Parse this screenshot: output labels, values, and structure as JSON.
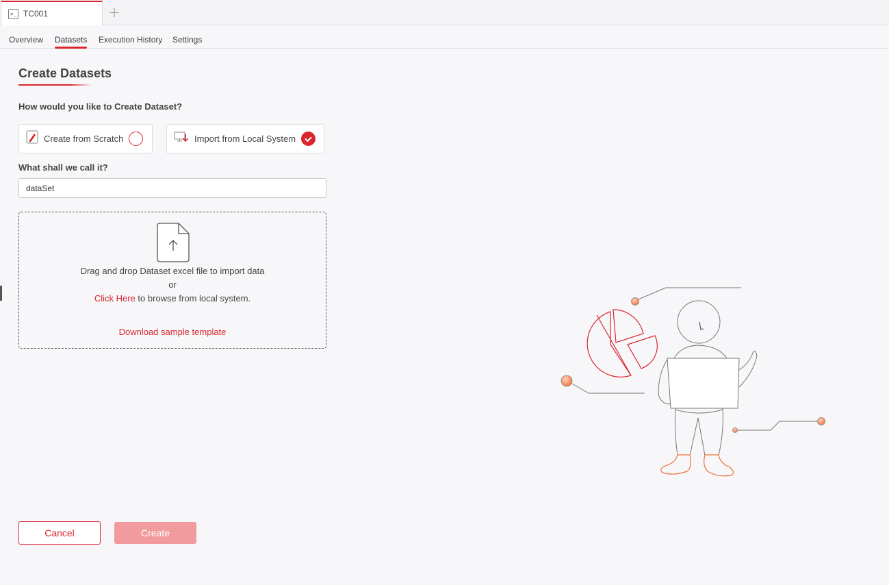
{
  "tabs": [
    {
      "label": "TC001"
    }
  ],
  "subnav": {
    "items": [
      {
        "label": "Overview"
      },
      {
        "label": "Datasets"
      },
      {
        "label": "Execution History"
      },
      {
        "label": "Settings"
      }
    ],
    "active": "Datasets"
  },
  "page": {
    "title": "Create Datasets",
    "question": "How would you like to Create Dataset?",
    "options": [
      {
        "label": "Create from Scratch",
        "icon": "pencil-icon",
        "selected": false
      },
      {
        "label": "Import from Local System",
        "icon": "import-monitor-icon",
        "selected": true
      }
    ],
    "name_label": "What shall we call it?",
    "name_value": "dataSet"
  },
  "dropzone": {
    "line1": "Drag and drop Dataset excel file to import data",
    "line2": "or",
    "link": "Click Here",
    "line3_rest": " to browse from local system.",
    "download": "Download sample template",
    "icon": "file-upload-icon"
  },
  "buttons": {
    "cancel": "Cancel",
    "create": "Create"
  },
  "colors": {
    "accent": "#d9262e",
    "disabled_button": "#f29b9e",
    "illustration_orange": "#f28c5a"
  }
}
